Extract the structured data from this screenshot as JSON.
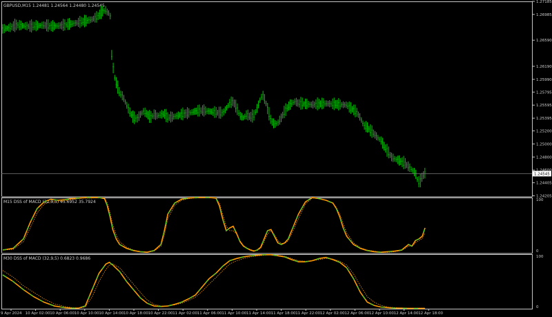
{
  "colors": {
    "background": "#000000",
    "candle": "#00c800",
    "axis": "#c8c8c8",
    "main_line": "#3cd02a",
    "signal_line": "#ff9a00",
    "signal_dotted": "#ff9a00",
    "price_line": "#7a7a7a",
    "price_badge_bg": "#ffffff",
    "price_badge_text": "#000000"
  },
  "chart_data": [
    {
      "type": "candlestick",
      "title": "GBPUSD,M15  1.24481 1.24564 1.24480 1.24545",
      "symbol": "GBPUSD",
      "timeframe": "M15",
      "ohlc": {
        "open": 1.24481,
        "high": 1.24564,
        "low": 1.2448,
        "close": 1.24545
      },
      "current_price": 1.24545,
      "current_price_label": "1.24545",
      "ylim": [
        1.242,
        1.27185
      ],
      "y_ticks": [
        1.27185,
        1.26985,
        1.2659,
        1.2619,
        1.2599,
        1.25795,
        1.25595,
        1.25395,
        1.252,
        1.25,
        1.248,
        1.246,
        1.24405,
        1.24205
      ],
      "y_tick_labels": [
        "1.27185",
        "1.26985",
        "1.26590",
        "1.26190",
        "1.25990",
        "1.25795",
        "1.25595",
        "1.25395",
        "1.25200",
        "1.25000",
        "1.24800",
        "1.24600",
        "1.24405",
        "1.24205"
      ],
      "xlim": [
        0,
        614
      ],
      "series": [
        {
          "x": [
            0,
            10,
            20,
            30,
            40,
            50,
            60,
            70,
            80,
            90,
            100,
            110,
            120,
            130,
            138,
            145,
            150,
            153,
            156,
            158,
            160,
            163,
            166,
            170,
            175,
            180,
            185,
            190,
            195,
            200,
            205,
            210,
            215,
            220,
            225,
            230,
            235,
            240,
            250,
            260,
            270,
            280,
            290,
            300,
            310,
            320,
            330,
            335,
            340,
            345,
            350,
            355,
            360,
            365,
            370,
            375,
            378,
            382,
            386,
            390,
            395,
            400,
            405,
            410,
            415,
            420,
            425,
            430,
            440,
            450,
            460,
            470,
            480,
            490,
            500,
            505,
            510,
            515,
            520,
            525,
            530,
            535,
            540,
            545,
            550,
            555,
            560,
            565,
            570,
            575,
            580,
            585,
            590,
            595,
            600,
            603,
            606,
            610,
            614
          ],
          "values": [
            1.2676,
            1.2678,
            1.2682,
            1.2681,
            1.268,
            1.2681,
            1.2682,
            1.268,
            1.2681,
            1.2682,
            1.2684,
            1.2686,
            1.2688,
            1.2691,
            1.2695,
            1.2703,
            1.2705,
            1.27,
            1.2702,
            1.264,
            1.262,
            1.26,
            1.259,
            1.2578,
            1.2572,
            1.256,
            1.2548,
            1.254,
            1.2538,
            1.2545,
            1.255,
            1.2545,
            1.254,
            1.2545,
            1.2543,
            1.2545,
            1.2546,
            1.254,
            1.2542,
            1.2545,
            1.2547,
            1.255,
            1.2551,
            1.255,
            1.2548,
            1.2547,
            1.2562,
            1.2565,
            1.2555,
            1.2543,
            1.254,
            1.2545,
            1.2541,
            1.2543,
            1.2555,
            1.257,
            1.2575,
            1.2565,
            1.255,
            1.2535,
            1.253,
            1.2532,
            1.254,
            1.255,
            1.2557,
            1.2562,
            1.2565,
            1.2562,
            1.2561,
            1.256,
            1.2561,
            1.2562,
            1.2561,
            1.256,
            1.256,
            1.2555,
            1.2552,
            1.2548,
            1.254,
            1.2528,
            1.2525,
            1.252,
            1.2515,
            1.251,
            1.2505,
            1.2495,
            1.2488,
            1.248,
            1.2477,
            1.2475,
            1.2472,
            1.247,
            1.2465,
            1.246,
            1.2455,
            1.2445,
            1.244,
            1.245,
            1.2455
          ]
        }
      ]
    },
    {
      "type": "line",
      "title": "M15 DSS of MACD (32,9,5) 45.6952 35.7924",
      "ylim": [
        0,
        100
      ],
      "y_ticks": [
        100,
        0
      ],
      "y_tick_labels": [
        "100",
        "0"
      ],
      "xlim": [
        0,
        614
      ],
      "series": [
        {
          "x": [
            0,
            15,
            30,
            40,
            50,
            60,
            70,
            80,
            90,
            100,
            110,
            120,
            130,
            140,
            148,
            152,
            156,
            160,
            165,
            170,
            180,
            190,
            200,
            210,
            220,
            230,
            235,
            240,
            250,
            260,
            270,
            280,
            290,
            300,
            310,
            315,
            320,
            325,
            330,
            335,
            340,
            345,
            350,
            355,
            360,
            365,
            370,
            375,
            380,
            385,
            390,
            395,
            400,
            405,
            410,
            415,
            420,
            430,
            440,
            450,
            460,
            470,
            480,
            485,
            490,
            495,
            500,
            510,
            520,
            530,
            540,
            550,
            560,
            570,
            575,
            580,
            585,
            590,
            595,
            600,
            605,
            610,
            614
          ],
          "values": [
            5,
            8,
            25,
            55,
            80,
            92,
            97,
            95,
            96,
            98,
            99,
            100,
            100,
            100,
            98,
            85,
            65,
            42,
            25,
            15,
            8,
            4,
            2,
            1,
            4,
            15,
            40,
            70,
            90,
            97,
            99,
            100,
            100,
            100,
            99,
            85,
            60,
            40,
            45,
            48,
            35,
            20,
            12,
            8,
            5,
            3,
            5,
            10,
            25,
            40,
            42,
            30,
            18,
            15,
            18,
            25,
            40,
            70,
            92,
            100,
            98,
            95,
            90,
            80,
            65,
            45,
            30,
            15,
            8,
            4,
            2,
            1,
            2,
            3,
            4,
            5,
            10,
            15,
            12,
            22,
            25,
            30,
            45
          ]
        },
        {
          "x": [
            0,
            15,
            30,
            40,
            50,
            60,
            70,
            80,
            90,
            100,
            110,
            120,
            130,
            140,
            148,
            152,
            156,
            160,
            165,
            170,
            180,
            190,
            200,
            210,
            220,
            230,
            235,
            240,
            250,
            260,
            270,
            280,
            290,
            300,
            310,
            315,
            320,
            325,
            330,
            335,
            340,
            345,
            350,
            355,
            360,
            365,
            370,
            375,
            380,
            385,
            390,
            395,
            400,
            405,
            410,
            415,
            420,
            430,
            440,
            450,
            460,
            470,
            480,
            485,
            490,
            495,
            500,
            510,
            520,
            530,
            540,
            550,
            560,
            570,
            575,
            580,
            585,
            590,
            595,
            600,
            605,
            610,
            614
          ],
          "values": [
            5,
            6,
            20,
            45,
            72,
            88,
            93,
            92,
            94,
            96,
            98,
            99,
            99,
            100,
            99,
            90,
            72,
            50,
            32,
            20,
            10,
            5,
            2,
            1,
            3,
            12,
            32,
            62,
            86,
            95,
            98,
            99,
            100,
            100,
            99,
            90,
            68,
            48,
            40,
            40,
            34,
            22,
            13,
            9,
            6,
            4,
            4,
            8,
            20,
            34,
            40,
            33,
            22,
            17,
            17,
            22,
            34,
            62,
            88,
            99,
            98,
            95,
            90,
            82,
            70,
            52,
            36,
            18,
            9,
            5,
            3,
            1,
            1,
            2,
            3,
            4,
            8,
            12,
            12,
            18,
            22,
            26,
            36
          ]
        }
      ]
    },
    {
      "type": "line",
      "title": "M30 DSS of MACD (32,9,5) 0.6823 0.9686",
      "ylim": [
        0,
        100
      ],
      "y_ticks": [
        100,
        0
      ],
      "y_tick_labels": [
        "100",
        "0"
      ],
      "xlim": [
        0,
        614
      ],
      "x_tick_labels": [
        "9 Apr 2024",
        "10 Apr 02:00",
        "10 Apr 06:00",
        "10 Apr 10:00",
        "10 Apr 14:00",
        "10 Apr 18:00",
        "10 Apr 22:00",
        "11 Apr 02:00",
        "11 Apr 06:00",
        "11 Apr 10:00",
        "11 Apr 14:00",
        "11 Apr 18:00",
        "11 Apr 22:00",
        "12 Apr 02:00",
        "12 Apr 06:00",
        "12 Apr 10:00",
        "12 Apr 14:00",
        "12 Apr 18:00"
      ],
      "series": [
        {
          "x": [
            0,
            15,
            30,
            45,
            60,
            75,
            90,
            100,
            110,
            120,
            130,
            140,
            150,
            155,
            160,
            170,
            180,
            190,
            200,
            210,
            220,
            230,
            240,
            250,
            260,
            270,
            280,
            290,
            300,
            310,
            320,
            330,
            340,
            350,
            360,
            370,
            380,
            390,
            400,
            410,
            420,
            430,
            440,
            450,
            460,
            470,
            480,
            490,
            500,
            510,
            520,
            530,
            540,
            550,
            560,
            570,
            580,
            590,
            600,
            610,
            614
          ],
          "values": [
            62,
            50,
            35,
            22,
            12,
            5,
            2,
            1,
            1,
            5,
            35,
            65,
            82,
            85,
            80,
            68,
            50,
            35,
            20,
            10,
            5,
            4,
            5,
            8,
            12,
            18,
            25,
            40,
            55,
            65,
            78,
            88,
            92,
            95,
            97,
            98,
            99,
            99,
            97,
            95,
            90,
            86,
            86,
            88,
            92,
            94,
            90,
            85,
            75,
            55,
            30,
            12,
            6,
            3,
            2,
            1,
            1,
            0.5,
            0.5,
            0.5,
            0.5
          ]
        },
        {
          "x": [
            0,
            15,
            30,
            45,
            60,
            75,
            90,
            100,
            110,
            120,
            130,
            140,
            150,
            155,
            160,
            170,
            180,
            190,
            200,
            210,
            220,
            230,
            240,
            250,
            260,
            270,
            280,
            290,
            300,
            310,
            320,
            330,
            340,
            350,
            360,
            370,
            380,
            390,
            400,
            410,
            420,
            430,
            440,
            450,
            460,
            470,
            480,
            490,
            500,
            510,
            520,
            530,
            540,
            550,
            560,
            570,
            580,
            590,
            600,
            610,
            614
          ],
          "values": [
            70,
            58,
            42,
            30,
            18,
            9,
            4,
            2,
            1,
            3,
            22,
            50,
            72,
            80,
            82,
            75,
            60,
            45,
            30,
            16,
            8,
            5,
            5,
            7,
            10,
            15,
            21,
            32,
            45,
            57,
            70,
            82,
            88,
            92,
            95,
            97,
            98,
            99,
            98,
            96,
            92,
            88,
            87,
            88,
            90,
            92,
            91,
            87,
            80,
            64,
            42,
            22,
            12,
            6,
            3,
            2,
            1,
            1,
            1,
            1,
            1
          ]
        }
      ]
    }
  ]
}
